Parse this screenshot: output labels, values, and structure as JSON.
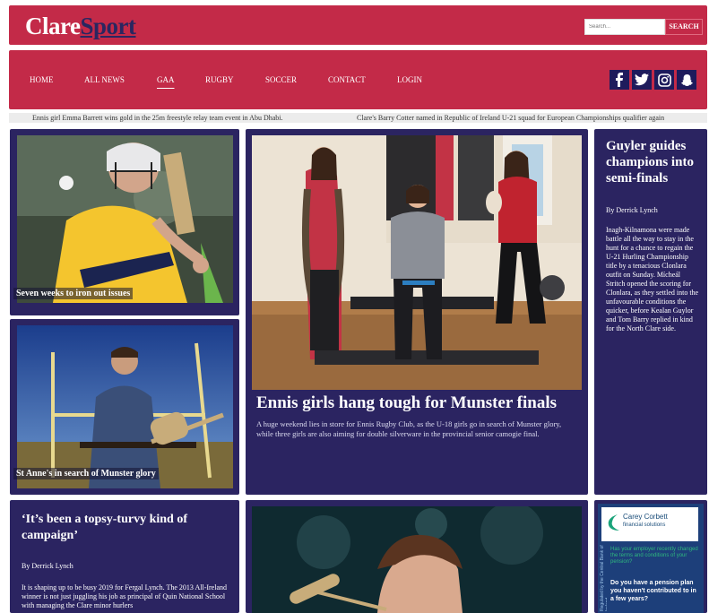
{
  "logo": {
    "part1": "Clare",
    "part2": "Sport"
  },
  "search": {
    "placeholder": "Search...",
    "button": "SEARCH"
  },
  "nav": [
    "HOME",
    "ALL NEWS",
    "GAA",
    "RUGBY",
    "SOCCER",
    "CONTACT",
    "LOGIN"
  ],
  "social": [
    "facebook-icon",
    "twitter-icon",
    "instagram-icon",
    "snapchat-icon"
  ],
  "ticker": [
    "Ennis girl Emma Barrett wins gold in the 25m freestyle relay team event in Abu Dhabi.",
    "Clare's Barry Cotter named in Republic of Ireland U-21 squad for European Championships qualifier again"
  ],
  "cards": {
    "hurler": {
      "caption": "Seven weeks to iron out issues"
    },
    "stanne": {
      "caption": "St Anne's in search of Munster glory"
    },
    "feature": {
      "title": "Ennis girls hang tough for Munster finals",
      "summary": "A huge weekend lies in store for Ennis Rugby Club, as the U-18 girls go in search of Munster glory, while three girls are also aiming for double silverware in the provincial senior camogie final."
    },
    "side": {
      "title": "Guyler guides champions into semi-finals",
      "byline": "By Derrick Lynch",
      "text": "Inagh-Kilnamona were made battle all the way to stay in the hunt for a chance to regain the U-21 Hurling Championship title by a tenacious Clonlara outfit on Sunday. Mícheál Stritch opened the scoring for Clonlara, as they settled into the unfavourable conditions the quicker, before Kealan Guylor and Tom Barry replied in kind for the North Clare side."
    },
    "topsy": {
      "title": "‘It’s been a topsy-turvy kind of campaign’",
      "byline": "By Derrick Lynch",
      "text": "It is shaping up to be busy 2019 for Fergal Lynch. The 2013 All-Ireland winner is not just juggling his job as principal of Quin National School with managing the Clare minor hurlers"
    },
    "ad": {
      "brand": "Carey Corbett",
      "sub": "financial solutions",
      "headline": "Do you have a pension plan you haven't contributed to in a few years?",
      "small": "Has your employer recently changed the terms and conditions of your pension?",
      "vertical": "Regulated by the Central Bank of Ireland"
    }
  }
}
